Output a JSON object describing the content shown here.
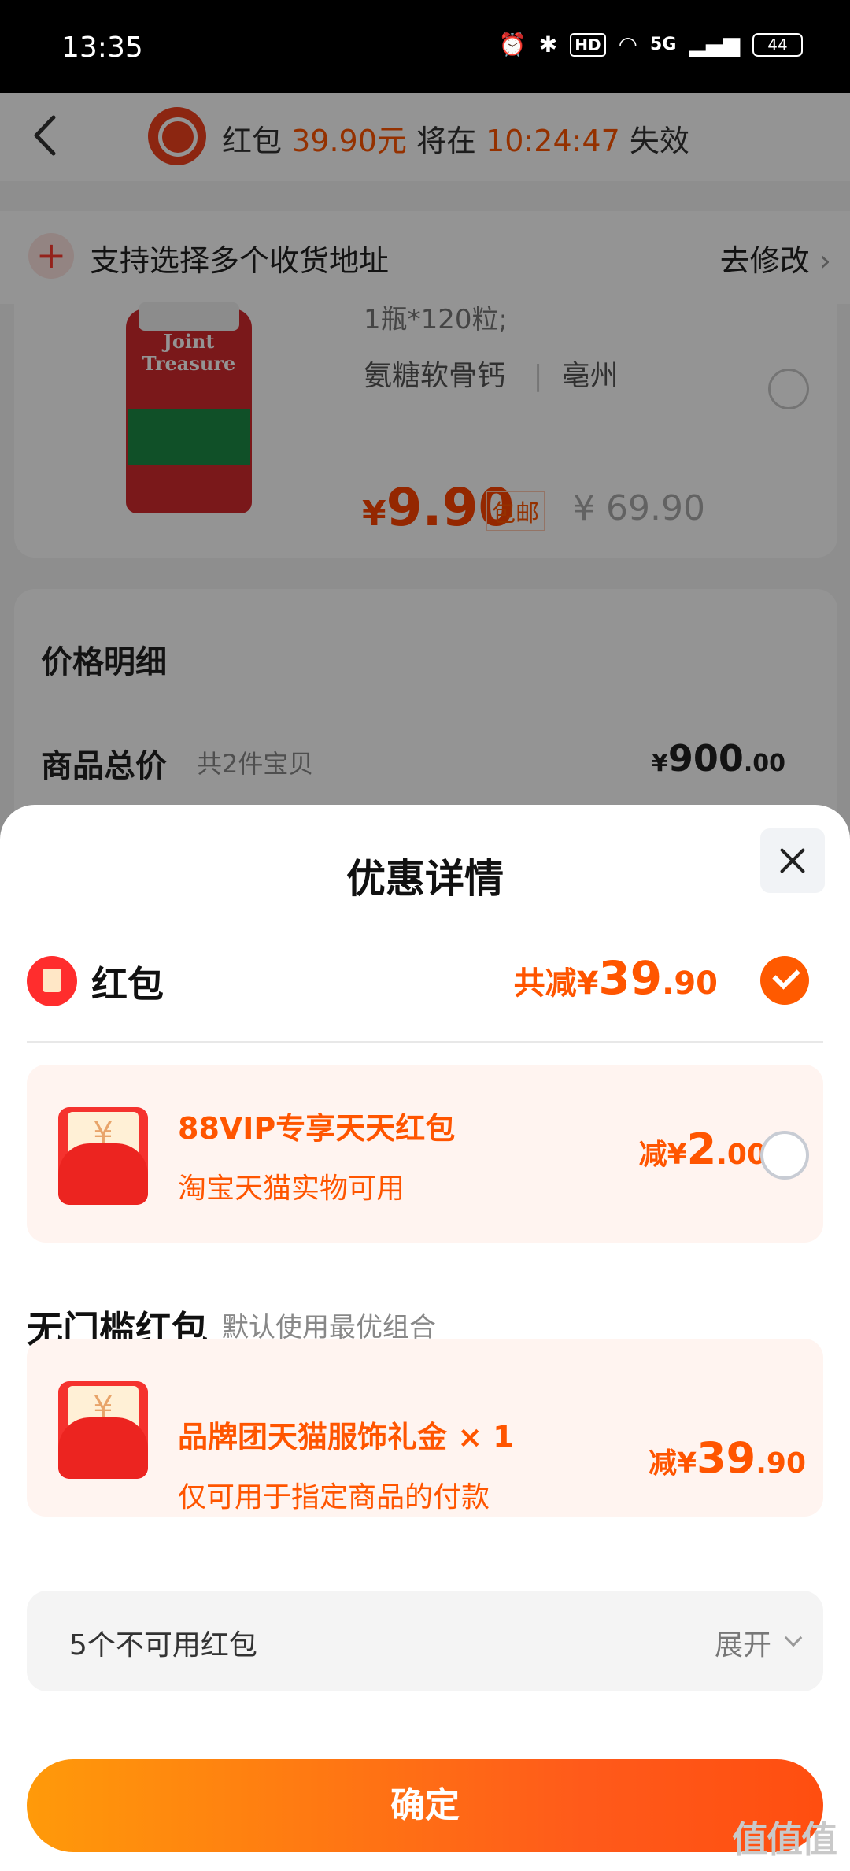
{
  "status_bar": {
    "time": "13:35",
    "hd": "HD",
    "network": "5G",
    "battery": "44"
  },
  "countdown": {
    "prefix": "红包",
    "amount": "39.90元",
    "middle": "将在",
    "time": "10:24:47",
    "suffix": "失效"
  },
  "address": {
    "text": "支持选择多个收货地址",
    "action": "去修改"
  },
  "product": {
    "image_text": "Joint Treasure",
    "spec": "1瓶*120粒;",
    "tag1": "氨糖软骨钙",
    "tag_sep": "|",
    "tag2": "亳州",
    "price_symbol": "¥",
    "price": "9.90",
    "shipping": "包邮",
    "original_price": "¥ 69.90"
  },
  "price_detail": {
    "title": "价格明细",
    "total_label": "商品总价",
    "count": "共2件宝贝",
    "amount_symbol": "¥",
    "amount_int": "900",
    "amount_dec": ".00"
  },
  "sheet": {
    "title": "优惠详情",
    "redpacket_label": "红包",
    "total_prefix": "共减¥",
    "total_int": "39",
    "total_dec": ".90",
    "coupons": [
      {
        "title": "88VIP专享天天红包",
        "subtitle": "淘宝天猫实物可用",
        "prefix": "减¥",
        "int": "2",
        "dec": ".00",
        "envelope_symbol": "¥"
      },
      {
        "title": "品牌团天猫服饰礼金 × 1",
        "subtitle": "仅可用于指定商品的付款",
        "prefix": "减¥",
        "int": "39",
        "dec": ".90",
        "envelope_symbol": "¥"
      }
    ],
    "section_title": "无门槛红包",
    "section_sub": "默认使用最优组合",
    "unavailable_text": "5个不可用红包",
    "expand_label": "展开",
    "confirm_label": "确定"
  },
  "watermark": "值值值",
  "colors": {
    "accent": "#ff5500",
    "red": "#f5322e",
    "card_bg": "#fff4f0"
  }
}
